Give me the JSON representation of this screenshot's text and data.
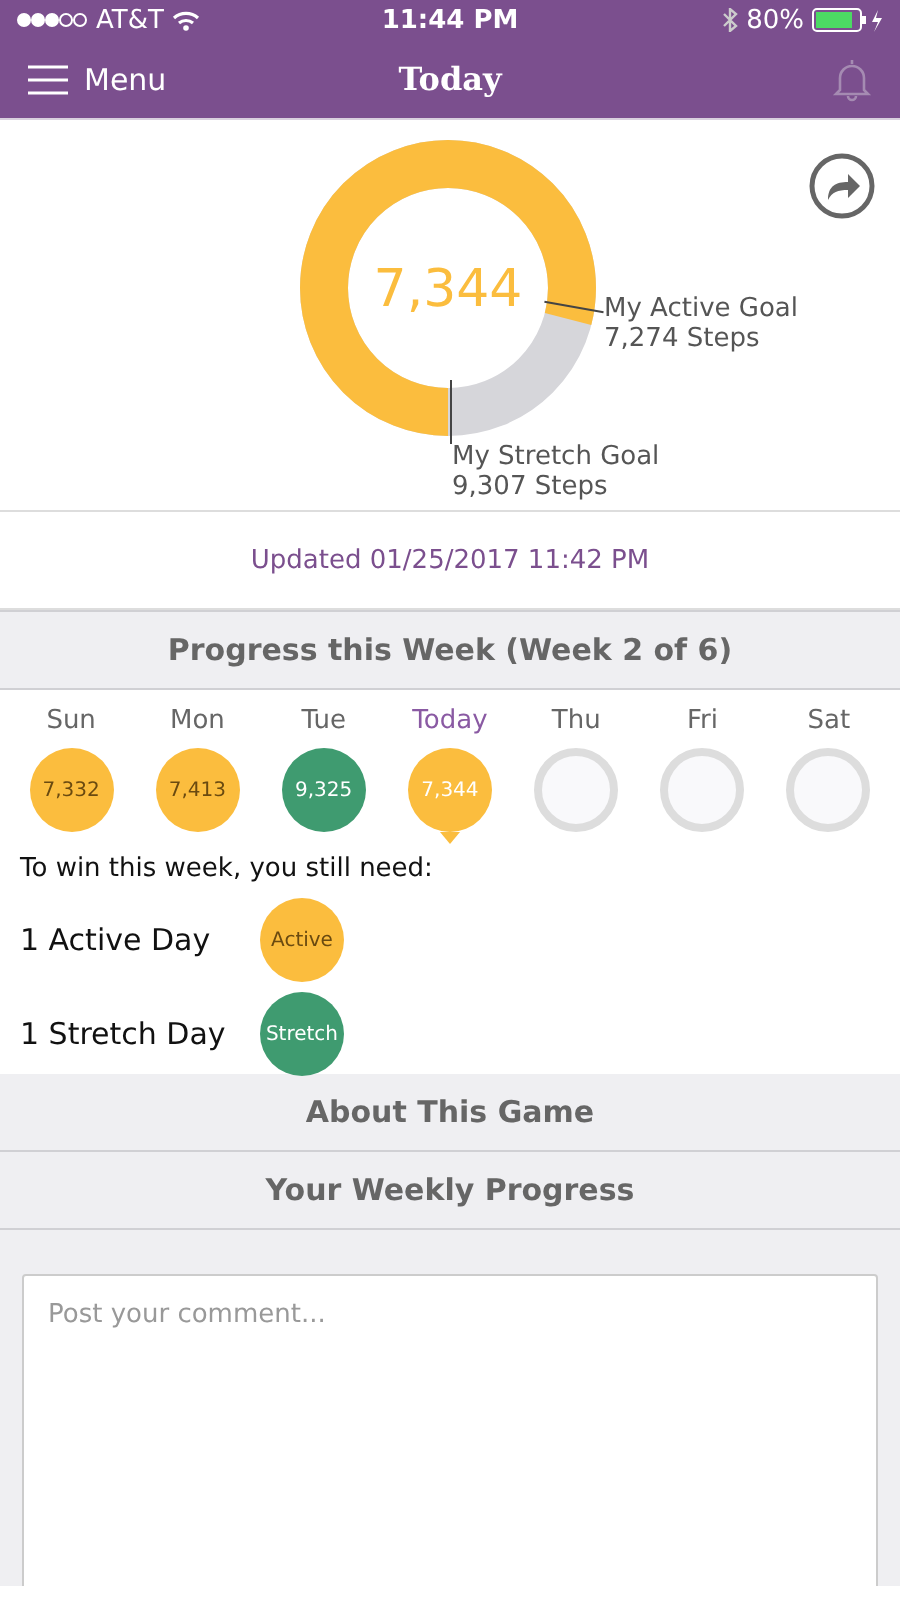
{
  "status_bar": {
    "carrier": "AT&T",
    "time": "11:44 PM",
    "battery": "80%"
  },
  "nav": {
    "menu": "Menu",
    "title": "Today"
  },
  "goal_ring": {
    "steps": "7,344",
    "active_goal": {
      "label": "My Active Goal",
      "steps": "7,274 Steps"
    },
    "stretch_goal": {
      "label": "My Stretch Goal",
      "steps": "9,307 Steps"
    }
  },
  "updated": "Updated 01/25/2017 11:42 PM",
  "progress_header": "Progress this Week (Week 2 of 6)",
  "days": [
    {
      "label": "Sun",
      "value": "7,332",
      "kind": "active",
      "selected": false
    },
    {
      "label": "Mon",
      "value": "7,413",
      "kind": "active",
      "selected": false
    },
    {
      "label": "Tue",
      "value": "9,325",
      "kind": "stretch",
      "selected": false
    },
    {
      "label": "Today",
      "value": "7,344",
      "kind": "active",
      "selected": true
    },
    {
      "label": "Thu",
      "kind": "empty",
      "selected": false
    },
    {
      "label": "Fri",
      "kind": "empty",
      "selected": false
    },
    {
      "label": "Sat",
      "kind": "empty",
      "selected": false
    }
  ],
  "needs": {
    "intro": "To win this week, you still need:",
    "items": [
      {
        "label": "1 Active Day",
        "badge": "Active",
        "kind": "active"
      },
      {
        "label": "1 Stretch Day",
        "badge": "Stretch",
        "kind": "stretch"
      }
    ]
  },
  "sections": [
    "About This Game",
    "Your Weekly Progress"
  ],
  "comment": {
    "placeholder": "Post your comment..."
  }
}
